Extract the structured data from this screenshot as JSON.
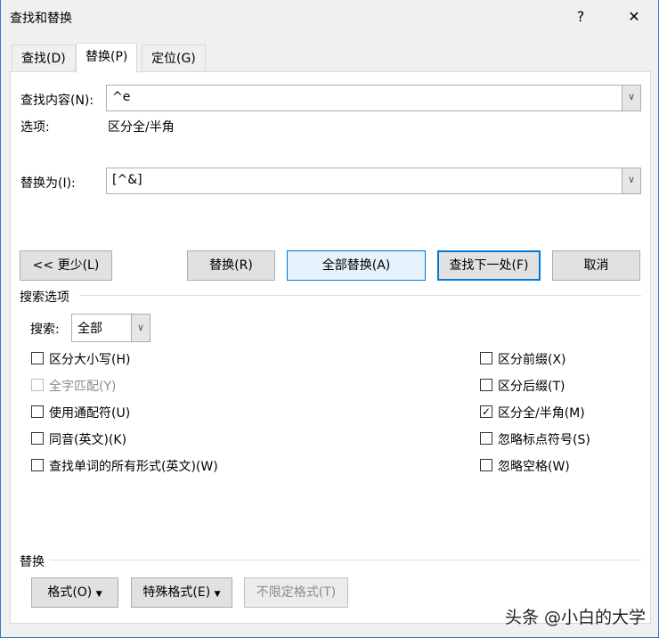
{
  "window": {
    "title": "查找和替换",
    "help": "?",
    "close": "✕"
  },
  "tabs": [
    {
      "label": "查找(D)"
    },
    {
      "label": "替换(P)"
    },
    {
      "label": "定位(G)"
    }
  ],
  "find": {
    "label": "查找内容(N):",
    "value": "^e",
    "options_label": "选项:",
    "options_value": "区分全/半角"
  },
  "replace": {
    "label": "替换为(I):",
    "value": "[^&]"
  },
  "buttons": {
    "less": "<< 更少(L)",
    "replace": "替换(R)",
    "replace_all": "全部替换(A)",
    "find_next": "查找下一处(F)",
    "cancel": "取消"
  },
  "search_options": {
    "heading": "搜索选项",
    "search_label": "搜索:",
    "search_value": "全部",
    "left": [
      {
        "label": "区分大小写(H)",
        "checked": false,
        "disabled": false
      },
      {
        "label": "全字匹配(Y)",
        "checked": false,
        "disabled": true
      },
      {
        "label": "使用通配符(U)",
        "checked": false,
        "disabled": false
      },
      {
        "label": "同音(英文)(K)",
        "checked": false,
        "disabled": false
      },
      {
        "label": "查找单词的所有形式(英文)(W)",
        "checked": false,
        "disabled": false
      }
    ],
    "right": [
      {
        "label": "区分前缀(X)",
        "checked": false
      },
      {
        "label": "区分后缀(T)",
        "checked": false
      },
      {
        "label": "区分全/半角(M)",
        "checked": true
      },
      {
        "label": "忽略标点符号(S)",
        "checked": false
      },
      {
        "label": "忽略空格(W)",
        "checked": false
      }
    ]
  },
  "replace_section": {
    "heading": "替换",
    "format": "格式(O)",
    "special": "特殊格式(E)",
    "no_format": "不限定格式(T)"
  },
  "watermark": "头条 @小白的大学"
}
